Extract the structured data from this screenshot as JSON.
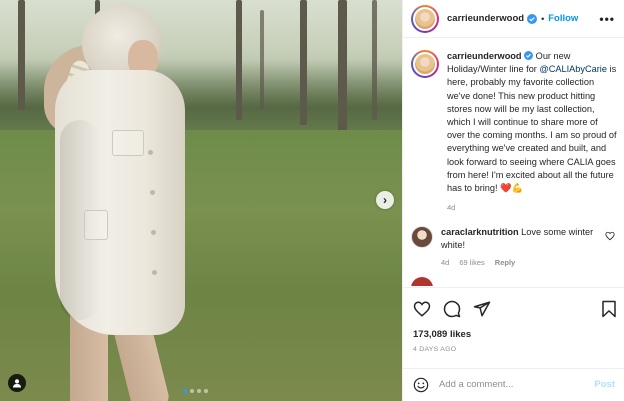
{
  "post": {
    "username": "carrieunderwood",
    "follow_label": "Follow",
    "separator": "•",
    "more_label": "•••"
  },
  "caption": {
    "username": "carrieunderwood",
    "text_before": "Our new Holiday/Winter line for ",
    "mention": "@CALIAbyCarie",
    "text_after": " is here, probably my favorite collection we've done! This new product hitting stores now will be my last collection, which I will continue to share more of over the coming months. I am so proud of everything we've created and built, and look forward to seeing where CALIA goes from here! I'm excited about all the future has to bring!",
    "emojis": "❤️💪",
    "time": "4d"
  },
  "comments": [
    {
      "username": "caraclarknutrition",
      "text": "Love some winter white!",
      "time": "4d",
      "likes": "69 likes",
      "reply_label": "Reply"
    }
  ],
  "footer": {
    "likes": "173,089 likes",
    "ago": "4 DAYS AGO",
    "add_comment_placeholder": "Add a comment...",
    "post_label": "Post"
  },
  "carousel": {
    "slide_count": 4,
    "active_index": 0,
    "next_glyph": "›"
  },
  "colors": {
    "accent": "#0095f6",
    "post_disabled": "#b2dffc",
    "muted": "#8e8e8e",
    "text": "#262626"
  }
}
